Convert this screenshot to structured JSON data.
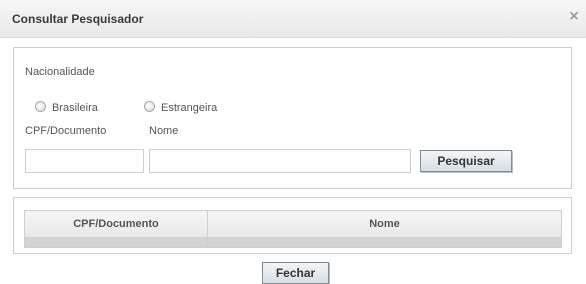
{
  "dialog": {
    "title": "Consultar Pesquisador",
    "close_glyph": "×"
  },
  "search": {
    "nationality_label": "Nacionalidade",
    "nationality_options": [
      {
        "label": "Brasileira",
        "selected": false
      },
      {
        "label": "Estrangeira",
        "selected": false
      }
    ],
    "cpf_label": "CPF/Documento",
    "cpf_value": "",
    "name_label": "Nome",
    "name_value": "",
    "search_button": "Pesquisar"
  },
  "results": {
    "columns": [
      "CPF/Documento",
      "Nome"
    ],
    "rows": []
  },
  "footer": {
    "close_button": "Fechar"
  },
  "colors": {
    "border": "#cfcfcf",
    "empty_row": "#d4d4d4",
    "button_border": "#7f8c99"
  }
}
